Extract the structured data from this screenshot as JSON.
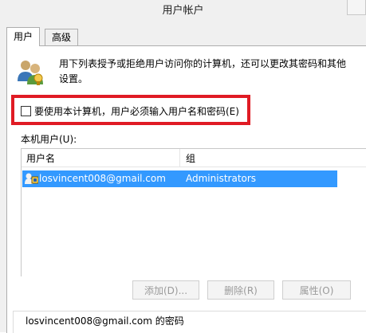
{
  "window": {
    "title": "用户帐户"
  },
  "tabs": [
    {
      "label": "用户",
      "active": true
    },
    {
      "label": "高级",
      "active": false
    }
  ],
  "description": "用下列表授予或拒绝用户访问你的计算机，还可以更改其密码和其他设置。",
  "require_login_checkbox": {
    "label": "要使用本计算机，用户必须输入用户名和密码(E)",
    "checked": false
  },
  "users_section": {
    "label": "本机用户(U):",
    "columns": [
      "用户名",
      "组"
    ],
    "rows": [
      {
        "username": "losvincent008@gmail.com",
        "group": "Administrators",
        "selected": true
      }
    ]
  },
  "buttons": {
    "add": "添加(D)...",
    "remove": "删除(R)",
    "properties": "属性(O)"
  },
  "password_group": {
    "title": "losvincent008@gmail.com 的密码"
  },
  "colors": {
    "selection": "#3399ff",
    "highlight_border": "#e01b24"
  }
}
